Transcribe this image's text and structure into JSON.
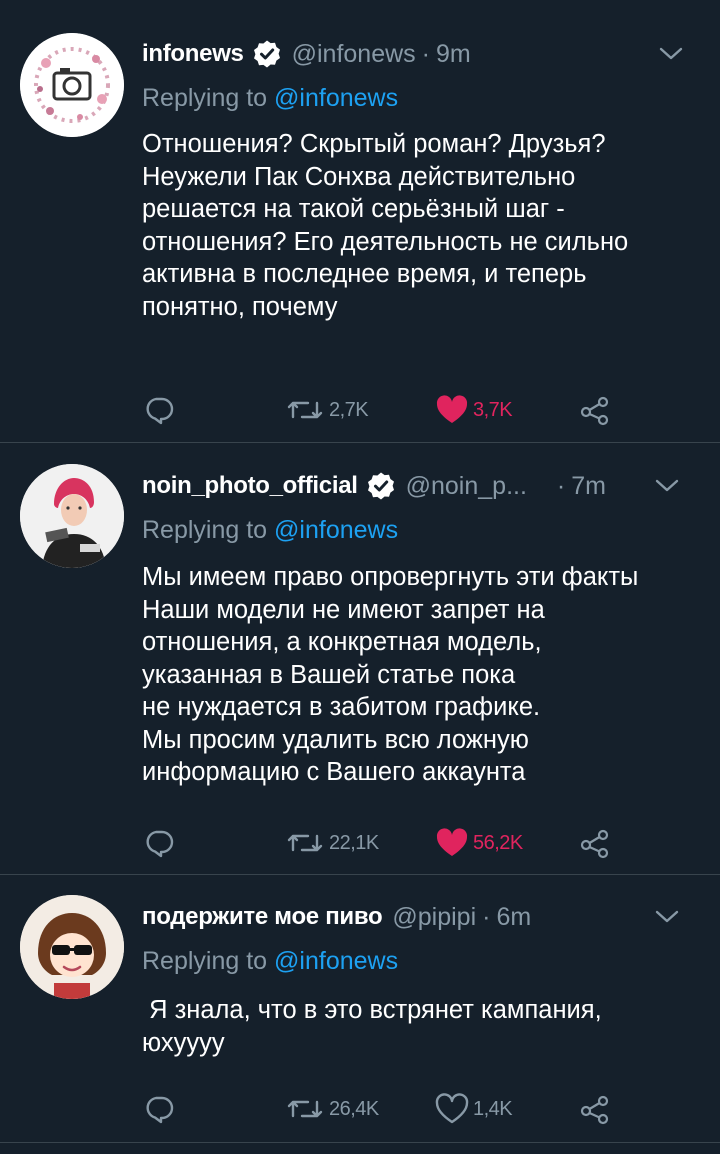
{
  "tweets": [
    {
      "name": "infonews",
      "handle": "@infonews",
      "dot": "·",
      "time": "9m",
      "replying_prefix": "Replying to ",
      "replying_to": "@infonews",
      "lines": [
        "Отношения? Скрытый роман? Друзья?",
        "Неужели Пак Сонхва действительно",
        "решается на такой серьёзный шаг -",
        "отношения? Его деятельность не сильно",
        "активна в последнее время, и теперь",
        "понятно, почему"
      ],
      "retweets": "2,7K",
      "likes": "3,7K",
      "liked": true,
      "verified": true
    },
    {
      "name": "noin_photo_official",
      "handle": "@noin_p...",
      "dot": "·",
      "time": "7m",
      "replying_prefix": "Replying to ",
      "replying_to": "@infonews",
      "lines": [
        "Мы имеем право опровергнуть эти факты",
        "Наши модели не имеют запрет на",
        "отношения, а конкретная модель,",
        "указанная в Вашей статье пока",
        "не нуждается в забитом графике.",
        "Мы просим удалить всю ложную",
        "информацию с Вашего аккаунта"
      ],
      "retweets": "22,1K",
      "likes": "56,2K",
      "liked": true,
      "verified": true
    },
    {
      "name": "подержите мое пиво",
      "handle": "@pipipi",
      "dot": "·",
      "time": "6m",
      "replying_prefix": "Replying to ",
      "replying_to": "@infonews",
      "lines": [
        " Я знала, что в это встрянет кампания,",
        "юхуууу"
      ],
      "retweets": "26,4K",
      "likes": "1,4K",
      "liked": false,
      "verified": false
    }
  ],
  "icons": {
    "reply": "reply-icon",
    "retweet": "retweet-icon",
    "like": "heart-icon",
    "share": "share-icon",
    "more": "chevron-down-icon",
    "verified": "verified-badge-icon"
  },
  "colors": {
    "background": "#15202b",
    "divider": "#38444d",
    "secondary_text": "#8899a6",
    "mention": "#1da1f2",
    "like": "#e0245e"
  }
}
